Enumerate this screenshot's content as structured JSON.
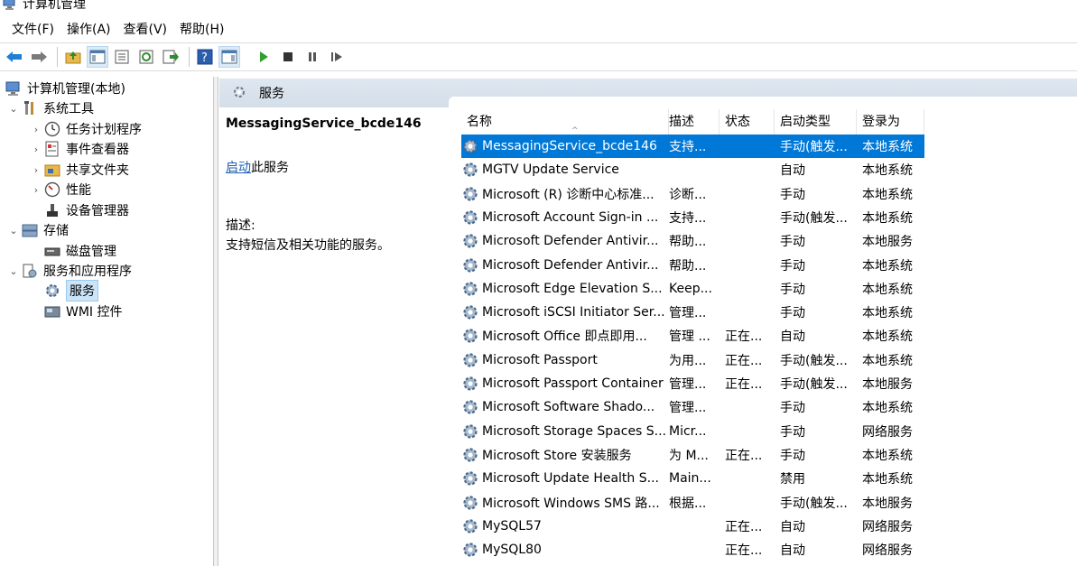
{
  "window": {
    "title": "计算机管理"
  },
  "menu": [
    "文件(F)",
    "操作(A)",
    "查看(V)",
    "帮助(H)"
  ],
  "toolbar": {
    "icons": [
      "back-arrow-icon",
      "forward-arrow-icon",
      "up-folder-icon",
      "show-hide-tree-icon",
      "properties-icon",
      "refresh-icon",
      "export-list-icon",
      "help-icon",
      "action-pane-icon",
      "play-icon",
      "stop-icon",
      "pause-icon",
      "resume-icon"
    ]
  },
  "tree": {
    "root": "计算机管理(本地)",
    "system_tools": "系统工具",
    "task_scheduler": "任务计划程序",
    "event_viewer": "事件查看器",
    "shared_folders": "共享文件夹",
    "performance": "性能",
    "device_manager": "设备管理器",
    "storage": "存储",
    "disk_management": "磁盘管理",
    "services_apps": "服务和应用程序",
    "services": "服务",
    "wmi": "WMI 控件"
  },
  "header": {
    "title": "服务"
  },
  "detail": {
    "service_name": "MessagingService_bcde146",
    "start_link": "启动",
    "start_suffix": "此服务",
    "desc_label": "描述:",
    "description": "支持短信及相关功能的服务。"
  },
  "columns": {
    "name": "名称",
    "desc": "描述",
    "status": "状态",
    "startup": "启动类型",
    "logon": "登录为"
  },
  "services": [
    {
      "name": "MessagingService_bcde146",
      "desc": "支持...",
      "status": "",
      "startup": "手动(触发...",
      "logon": "本地系统",
      "selected": true
    },
    {
      "name": "MGTV Update Service",
      "desc": "",
      "status": "",
      "startup": "自动",
      "logon": "本地系统"
    },
    {
      "name": "Microsoft (R) 诊断中心标准...",
      "desc": "诊断...",
      "status": "",
      "startup": "手动",
      "logon": "本地系统"
    },
    {
      "name": "Microsoft Account Sign-in ...",
      "desc": "支持...",
      "status": "",
      "startup": "手动(触发...",
      "logon": "本地系统"
    },
    {
      "name": "Microsoft Defender Antivir...",
      "desc": "帮助...",
      "status": "",
      "startup": "手动",
      "logon": "本地服务"
    },
    {
      "name": "Microsoft Defender Antivir...",
      "desc": "帮助...",
      "status": "",
      "startup": "手动",
      "logon": "本地系统"
    },
    {
      "name": "Microsoft Edge Elevation S...",
      "desc": "Keep...",
      "status": "",
      "startup": "手动",
      "logon": "本地系统"
    },
    {
      "name": "Microsoft iSCSI Initiator Ser...",
      "desc": "管理...",
      "status": "",
      "startup": "手动",
      "logon": "本地系统"
    },
    {
      "name": "Microsoft Office 即点即用...",
      "desc": "管理 ...",
      "status": "正在...",
      "startup": "自动",
      "logon": "本地系统"
    },
    {
      "name": "Microsoft Passport",
      "desc": "为用...",
      "status": "正在...",
      "startup": "手动(触发...",
      "logon": "本地系统"
    },
    {
      "name": "Microsoft Passport Container",
      "desc": "管理...",
      "status": "正在...",
      "startup": "手动(触发...",
      "logon": "本地服务"
    },
    {
      "name": "Microsoft Software Shado...",
      "desc": "管理...",
      "status": "",
      "startup": "手动",
      "logon": "本地系统"
    },
    {
      "name": "Microsoft Storage Spaces S...",
      "desc": "Micr...",
      "status": "",
      "startup": "手动",
      "logon": "网络服务"
    },
    {
      "name": "Microsoft Store 安装服务",
      "desc": "为 M...",
      "status": "正在...",
      "startup": "手动",
      "logon": "本地系统"
    },
    {
      "name": "Microsoft Update Health S...",
      "desc": "Main...",
      "status": "",
      "startup": "禁用",
      "logon": "本地系统"
    },
    {
      "name": "Microsoft Windows SMS 路...",
      "desc": "根据...",
      "status": "",
      "startup": "手动(触发...",
      "logon": "本地服务"
    },
    {
      "name": "MySQL57",
      "desc": "",
      "status": "正在...",
      "startup": "自动",
      "logon": "网络服务"
    },
    {
      "name": "MySQL80",
      "desc": "",
      "status": "正在...",
      "startup": "自动",
      "logon": "网络服务"
    }
  ],
  "colors": {
    "selection": "#0078d7",
    "header_bg": "#dfe7f0",
    "link": "#1a5fb4"
  }
}
